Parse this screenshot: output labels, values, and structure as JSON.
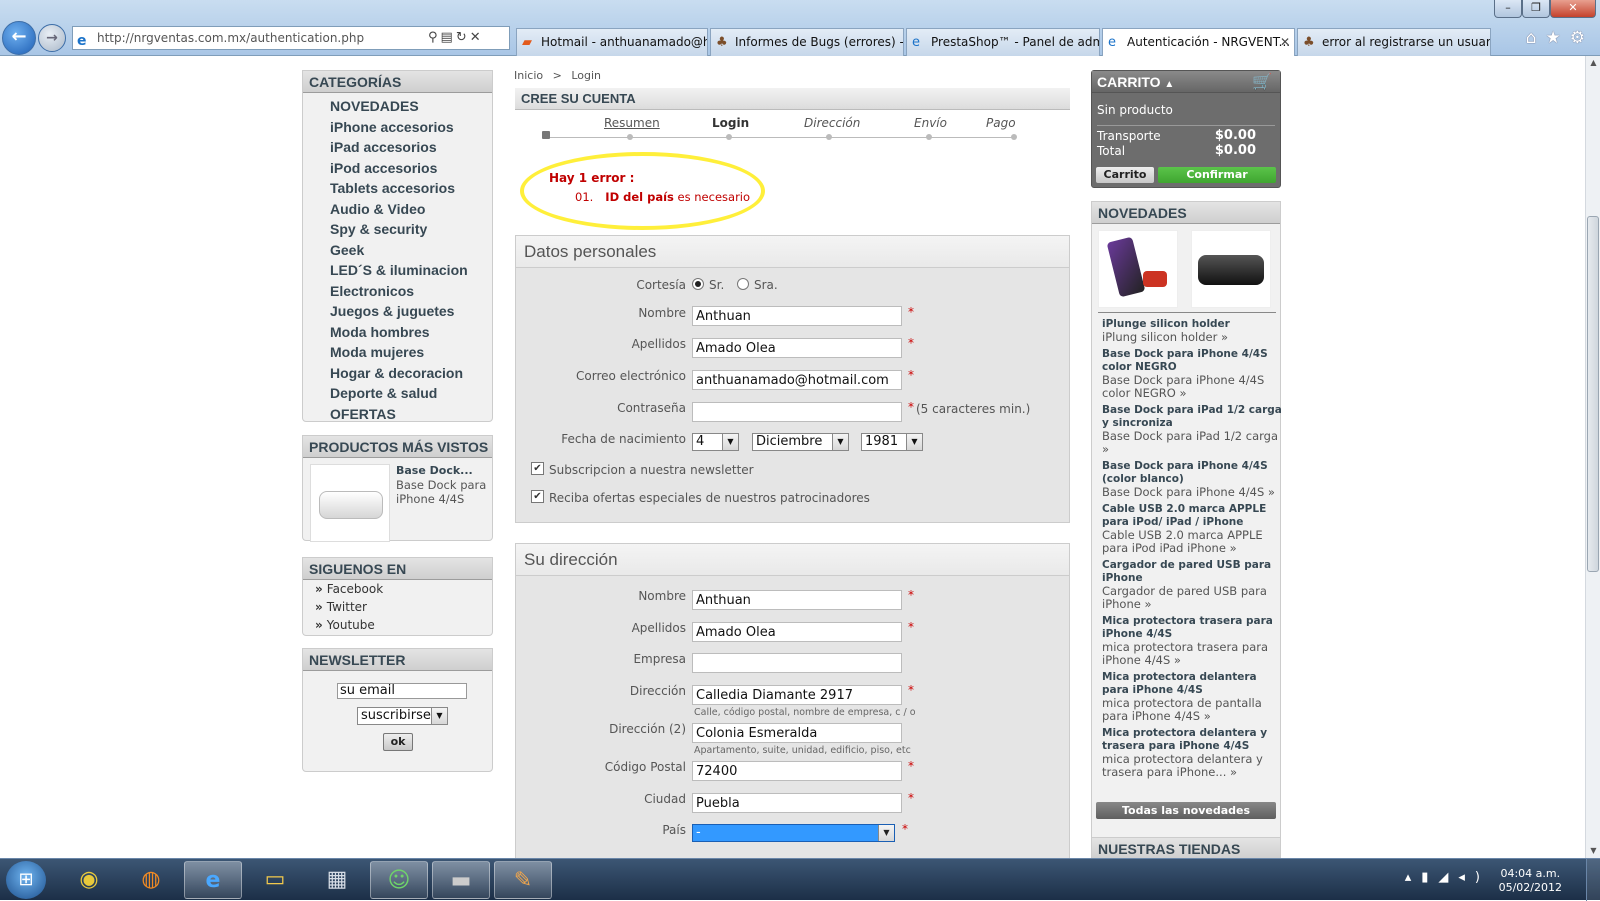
{
  "browser": {
    "url": "http://nrgventas.com.mx/authentication.php",
    "tabs": [
      {
        "label": "Hotmail - anthuanamado@h..."
      },
      {
        "label": "Informes de Bugs (errores) - P..."
      },
      {
        "label": "PrestaShop™ - Panel de admi..."
      },
      {
        "label": "Autenticación - NRGVENT..."
      },
      {
        "label": "error al registrarse un usuario ..."
      }
    ]
  },
  "left": {
    "categories_title": "CATEGORÍAS",
    "categories": [
      "NOVEDADES",
      "iPhone accesorios",
      "iPad accesorios",
      "iPod accesorios",
      "Tablets accesorios",
      "Audio & Video",
      "Spy & security",
      "Geek",
      "LED´S & iluminacion",
      "Electronicos",
      "Juegos & juguetes",
      "Moda hombres",
      "Moda mujeres",
      "Hogar & decoracion",
      "Deporte & salud",
      "OFERTAS"
    ],
    "viewed_title": "PRODUCTOS MÁS VISTOS",
    "viewed_name": "Base Dock...",
    "viewed_desc": "Base Dock para iPhone 4/4S",
    "follow_title": "SIGUENOS EN",
    "follow": [
      "Facebook",
      "Twitter",
      "Youtube"
    ],
    "newsletter_title": "NEWSLETTER",
    "newsletter_value": "su email",
    "newsletter_select": "suscribirse",
    "newsletter_ok": "ok"
  },
  "center": {
    "breadcrumb_home": "Inicio",
    "breadcrumb_sep": ">",
    "breadcrumb_current": "Login",
    "title": "CREE SU CUENTA",
    "steps": [
      "Resumen",
      "Login",
      "Dirección",
      "Envío",
      "Pago"
    ],
    "error_title": "Hay 1 error :",
    "error_num": "01.",
    "error_field": "ID del país",
    "error_msg": "es necesario",
    "personal": {
      "title": "Datos personales",
      "cortesia_label": "Cortesía",
      "sr": "Sr.",
      "sra": "Sra.",
      "nombre_label": "Nombre",
      "nombre": "Anthuan",
      "apellidos_label": "Apellidos",
      "apellidos": "Amado Olea",
      "email_label": "Correo electrónico",
      "email": "anthuanamado@hotmail.com",
      "pass_label": "Contraseña",
      "pass_hint": "(5 caracteres min.)",
      "birth_label": "Fecha de nacimiento",
      "day": "4",
      "month": "Diciembre",
      "year": "1981",
      "newsletter": "Subscripcion a nuestra newsletter",
      "offers": "Reciba ofertas especiales de nuestros patrocinadores"
    },
    "address": {
      "title": "Su dirección",
      "nombre_label": "Nombre",
      "nombre": "Anthuan",
      "apellidos_label": "Apellidos",
      "apellidos": "Amado Olea",
      "empresa_label": "Empresa",
      "empresa": "",
      "dir_label": "Dirección",
      "dir": "Calledia Diamante 2917",
      "dir_hint": "Calle, código postal, nombre de empresa, c / o",
      "dir2_label": "Dirección (2)",
      "dir2": "Colonia Esmeralda",
      "dir2_hint": "Apartamento, suite, unidad, edificio, piso, etc",
      "cp_label": "Código Postal",
      "cp": "72400",
      "ciudad_label": "Ciudad",
      "ciudad": "Puebla",
      "pais_label": "País",
      "pais": "-"
    }
  },
  "right": {
    "cart_title": "CARRITO",
    "cart_empty": "Sin producto",
    "transport_label": "Transporte",
    "transport": "$0.00",
    "total_label": "Total",
    "total": "$0.00",
    "cart_btn": "Carrito",
    "confirm_btn": "Confirmar",
    "novedades_title": "NOVEDADES",
    "novedades": [
      {
        "name": "iPlunge silicon holder",
        "desc": "iPlung silicon holder »"
      },
      {
        "name": "Base Dock para iPhone 4/4S color NEGRO",
        "desc": "Base Dock para iPhone 4/4S color NEGRO »"
      },
      {
        "name": "Base Dock para iPad 1/2 carga y sincroniza",
        "desc": "Base Dock para iPad 1/2 carga »"
      },
      {
        "name": "Base Dock para iPhone 4/4S (color blanco)",
        "desc": "Base Dock para iPhone 4/4S »"
      },
      {
        "name": "Cable USB 2.0 marca APPLE para iPod/ iPad / iPhone",
        "desc": "Cable USB 2.0 marca APPLE para iPod iPad iPhone »"
      },
      {
        "name": "Cargador de pared USB para iPhone",
        "desc": "Cargador de pared USB para iPhone »"
      },
      {
        "name": "Mica protectora trasera para iPhone 4/4S",
        "desc": "mica protectora trasera para iPhone 4/4S »"
      },
      {
        "name": "Mica protectora delantera para iPhone 4/4S",
        "desc": "mica protectora de pantalla para iPhone 4/4S »"
      },
      {
        "name": "Mica protectora delantera y trasera para iPhone 4/4S",
        "desc": "mica protectora delantera y trasera para iPhone... »"
      }
    ],
    "all_btn": "Todas las novedades",
    "stores_title": "NUESTRAS TIENDAS"
  },
  "taskbar": {
    "time": "04:04 a.m.",
    "date": "05/02/2012"
  },
  "colors": {
    "confirm": "#3fa530",
    "error": "#c00000",
    "highlight": "#ffef3a",
    "select": "#3399ff"
  }
}
